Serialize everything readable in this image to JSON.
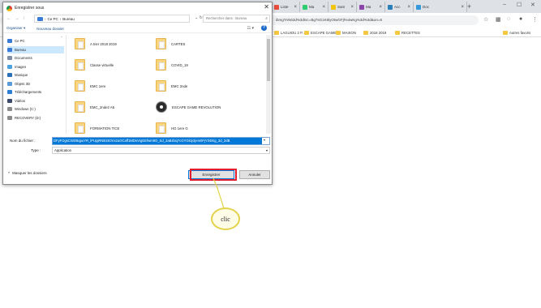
{
  "browser": {
    "tabs": [
      {
        "label": "",
        "color": "#e74c3c"
      },
      {
        "label": "Liste",
        "color": "#e74c3c"
      },
      {
        "label": "Ma",
        "color": "#2ecc71"
      },
      {
        "label": "Sam",
        "color": "#f1c40f"
      },
      {
        "label": "Ma",
        "color": "#8e44ad"
      },
      {
        "label": "Acc",
        "color": "#2980b9"
      },
      {
        "label": "Doc",
        "color": "#3498db"
      }
    ],
    "new_tab_glyph": "+",
    "address_text": "ibmgTAN63d%3dIsc=Bg7sG1K6lyOtwGFjl%4wKg%3d%3d&on=6",
    "bookmarks": [
      {
        "label": "LAGUIOU 2 P..."
      },
      {
        "label": "ESCAPE GAME"
      },
      {
        "label": "MAISON"
      },
      {
        "label": "2018 2019"
      },
      {
        "label": "RECETTES"
      }
    ],
    "other_bookmarks": "Autres favoris"
  },
  "dialog": {
    "title": "Enregistrer sous",
    "breadcrumb": [
      "Ce PC",
      "Bureau"
    ],
    "search_placeholder": "Rechercher dans : Bureau",
    "cmd": {
      "organiser": "Organiser ▾",
      "new_folder": "Nouveau dossier"
    },
    "nav_items": [
      {
        "label": "Ce PC",
        "color": "#3a7bd5"
      },
      {
        "label": "Bureau",
        "color": "#3a7bd5",
        "selected": true
      },
      {
        "label": "Documents",
        "color": "#7d8da6"
      },
      {
        "label": "Images",
        "color": "#4aa3df"
      },
      {
        "label": "Musique",
        "color": "#2a6fb7"
      },
      {
        "label": "Objets 3D",
        "color": "#5b9bd5"
      },
      {
        "label": "Téléchargements",
        "color": "#2d7dd2"
      },
      {
        "label": "Vidéos",
        "color": "#3b4a6b"
      },
      {
        "label": "Windows (C:)",
        "color": "#8a8a8a"
      },
      {
        "label": "RECOVERY (D:)",
        "color": "#8a8a8a"
      }
    ],
    "files": [
      {
        "label": "A trier 2018 2019",
        "kind": "folder"
      },
      {
        "label": "CARTES",
        "kind": "folder"
      },
      {
        "label": "Classe virtuelle",
        "kind": "folder"
      },
      {
        "label": "COVID_19",
        "kind": "folder"
      },
      {
        "label": "EMC 1ere",
        "kind": "folder"
      },
      {
        "label": "EMC 2nde",
        "kind": "folder"
      },
      {
        "label": "EMC_2nde2 A5",
        "kind": "folder"
      },
      {
        "label": "ESCAPE GAME REVOLUTION",
        "kind": "app"
      },
      {
        "label": "FORMATION TICE",
        "kind": "folder"
      },
      {
        "label": "HG 1ere G",
        "kind": "folder"
      }
    ],
    "filename_label": "Nom du fichier :",
    "filename_value": "DFyFOgsCWZBqpuYR_lPUpjRNB1E0Vx2aOCaff1MDsVrgEEfwm9O_Sd_2aBzbxj7cGYGkty2jem0FjYrl4tKg_3d_2dB",
    "type_label": "Type :",
    "type_value": "Application",
    "hide_folders": "Masquer les dossiers",
    "save_button": "Enregistrer",
    "cancel_button": "Annuler"
  },
  "annotation": {
    "text": "clic",
    "highlight_color": "#e11d2e",
    "callout_color": "#e3d24a"
  }
}
